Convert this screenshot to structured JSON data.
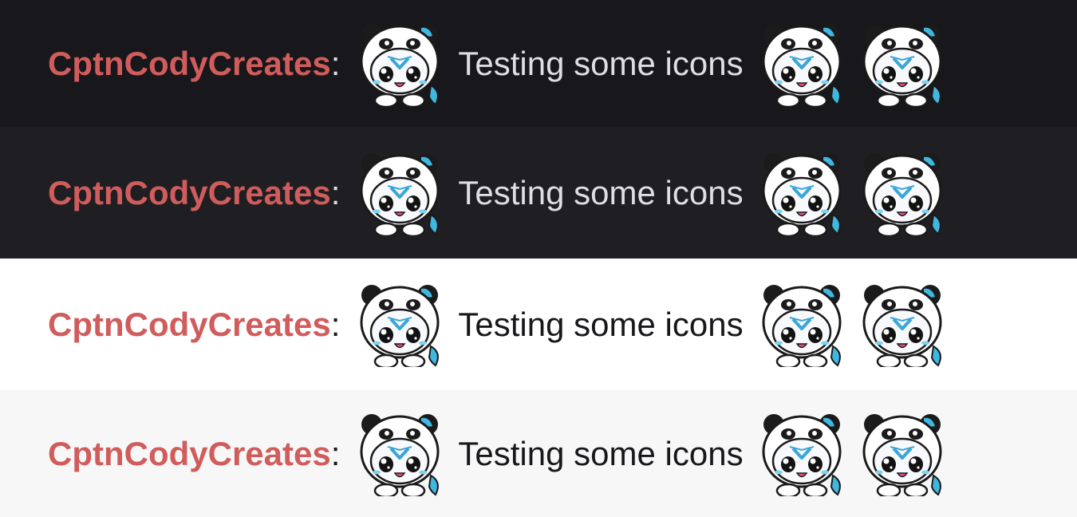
{
  "emote": {
    "name": "panda-cat-emote",
    "colors": {
      "outline": "#1a1a1a",
      "hood": "#ffffff",
      "hood_shadow": "#e3e6ee",
      "ears": "#1b1b1b",
      "ear_accent": "#3fb7e0",
      "face_mark": "#3aa6d8",
      "eyes": "#121212",
      "blush": "#7fd3ef",
      "mouth": "#e0507a"
    }
  },
  "colors": {
    "username": "#d15c5c",
    "dark_text": "#dedee3",
    "light_text": "#18181b",
    "row_backgrounds": [
      "#18171b",
      "#1f1f23",
      "#ffffff",
      "#f7f7f8"
    ]
  },
  "rows": [
    {
      "theme": "dark",
      "username": "CptnCodyCreates",
      "colon": ":",
      "text": "Testing some icons"
    },
    {
      "theme": "dark",
      "username": "CptnCodyCreates",
      "colon": ":",
      "text": "Testing some icons"
    },
    {
      "theme": "light",
      "username": "CptnCodyCreates",
      "colon": ":",
      "text": "Testing some icons"
    },
    {
      "theme": "light",
      "username": "CptnCodyCreates",
      "colon": ":",
      "text": "Testing some icons"
    }
  ]
}
